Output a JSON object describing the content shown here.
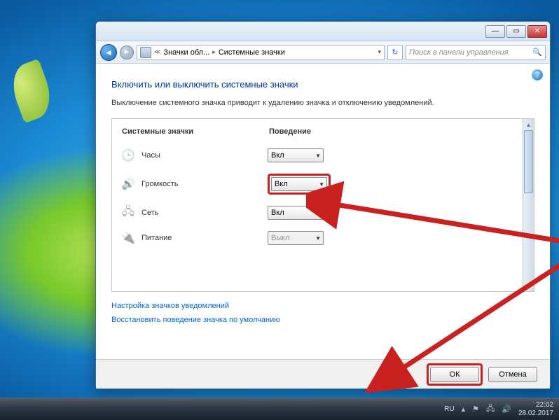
{
  "breadcrumb": {
    "item1": "Значки обл...",
    "item2": "Системные значки"
  },
  "search": {
    "placeholder": "Поиск в панели управления"
  },
  "page": {
    "title": "Включить или выключить системные значки",
    "desc": "Выключение системного значка приводит к удалению значка и отключению уведомлений."
  },
  "headers": {
    "col1": "Системные значки",
    "col2": "Поведение"
  },
  "rows": {
    "clock": {
      "label": "Часы",
      "value": "Вкл"
    },
    "volume": {
      "label": "Громкость",
      "value": "Вкл"
    },
    "network": {
      "label": "Сеть",
      "value": "Вкл"
    },
    "power": {
      "label": "Питание",
      "value": "Выкл"
    }
  },
  "links": {
    "customize": "Настройка значков уведомлений",
    "restore": "Восстановить поведение значка по умолчанию"
  },
  "buttons": {
    "ok": "ОК",
    "cancel": "Отмена"
  },
  "taskbar": {
    "lang": "RU",
    "time": "22:02",
    "date": "28.02.2017"
  }
}
